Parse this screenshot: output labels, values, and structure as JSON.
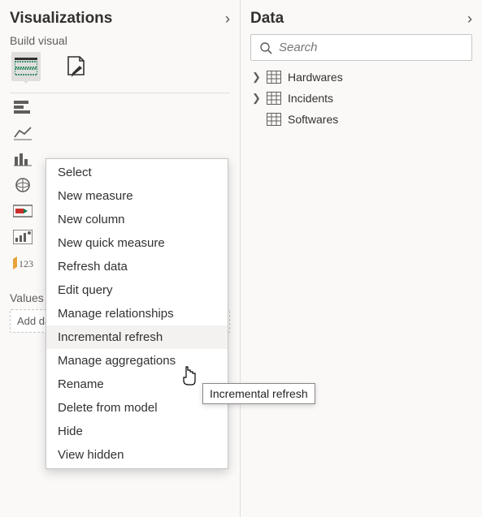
{
  "viz_panel": {
    "title": "Visualizations",
    "build_label": "Build visual",
    "values_label": "Values",
    "add_placeholder": "Add data fields here"
  },
  "data_panel": {
    "title": "Data",
    "search_placeholder": "Search",
    "tables": [
      {
        "name": "Hardwares"
      },
      {
        "name": "Incidents"
      },
      {
        "name": "Softwares"
      }
    ]
  },
  "context_menu": {
    "items": [
      "Select",
      "New measure",
      "New column",
      "New quick measure",
      "Refresh data",
      "Edit query",
      "Manage relationships",
      "Incremental refresh",
      "Manage aggregations",
      "Rename",
      "Delete from model",
      "Hide",
      "View hidden"
    ],
    "hovered": "Incremental refresh"
  },
  "tooltip": "Incremental refresh"
}
